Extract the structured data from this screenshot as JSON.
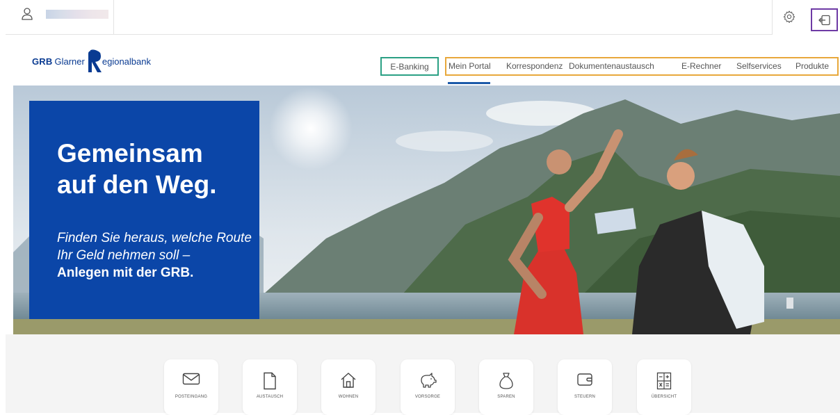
{
  "header": {
    "user_icon": "user-icon",
    "settings_icon": "gear-icon",
    "logout_icon": "logout-icon"
  },
  "logo": {
    "grb": "GRB",
    "glarner": "Glarner",
    "regionalbank": "egionalbank",
    "brand_color": "#0a3b92"
  },
  "nav": {
    "ebanking": "E-Banking",
    "items": [
      "Mein Portal",
      "Korrespondenz",
      "Dokumentenaustausch",
      "E-Rechner",
      "Selfservices",
      "Produkte"
    ],
    "active_index": 0,
    "highlight_colors": {
      "ebanking": "#2aa084",
      "group": "#e8a83b",
      "logout": "#6e3aa5",
      "active_underline": "#1d5aa9"
    }
  },
  "hero": {
    "title_line1": "Gemeinsam",
    "title_line2": "auf den Weg.",
    "subtitle": "Finden Sie heraus, welche Route Ihr Geld nehmen soll –",
    "cta": "Anlegen mit der GRB.",
    "box_color": "#0b46a8"
  },
  "tiles": [
    {
      "label": "POSTEINGANG",
      "icon": "envelope-icon"
    },
    {
      "label": "AUSTAUSCH",
      "icon": "document-icon"
    },
    {
      "label": "WOHNEN",
      "icon": "house-icon"
    },
    {
      "label": "VORSORGE",
      "icon": "piggy-bank-icon"
    },
    {
      "label": "SPAREN",
      "icon": "money-bag-icon"
    },
    {
      "label": "STEUERN",
      "icon": "wallet-icon"
    },
    {
      "label": "ÜBERSICHT",
      "icon": "calculator-icon"
    }
  ]
}
